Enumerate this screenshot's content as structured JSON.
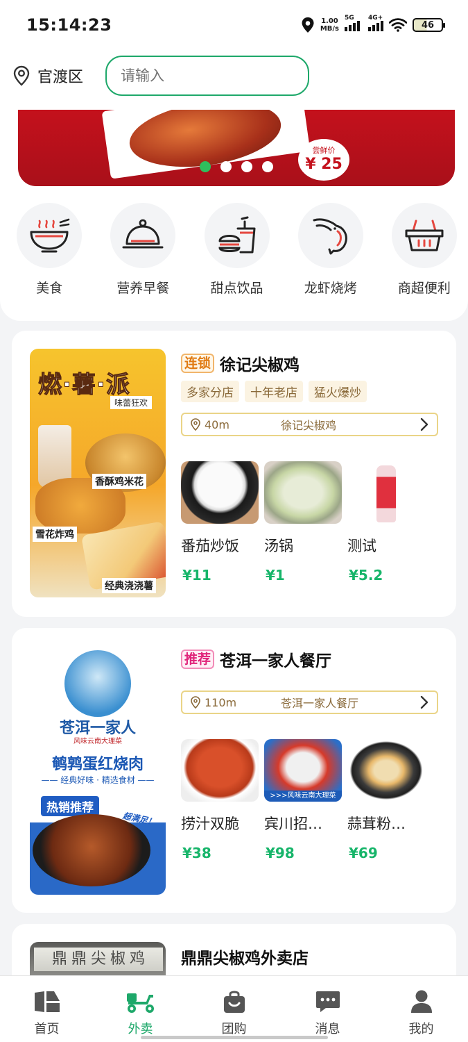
{
  "status_bar": {
    "time": "15:14:23",
    "net_speed_value": "1.00",
    "net_speed_unit": "MB/s",
    "signal1": "5G",
    "signal2": "4G+",
    "battery": "46"
  },
  "location": {
    "district": "官渡区"
  },
  "search": {
    "placeholder": "请输入"
  },
  "banner": {
    "price_label": "尝鲜价",
    "price": "¥ 25",
    "active_dot": 0,
    "dot_count": 4
  },
  "categories": [
    {
      "label": "美食",
      "icon": "bowl-icon"
    },
    {
      "label": "营养早餐",
      "icon": "cloche-icon"
    },
    {
      "label": "甜点饮品",
      "icon": "burger-drink-icon"
    },
    {
      "label": "龙虾烧烤",
      "icon": "shrimp-icon"
    },
    {
      "label": "商超便利",
      "icon": "basket-icon"
    }
  ],
  "stores": [
    {
      "badge": "连锁",
      "name": "徐记尖椒鸡",
      "tags": [
        "多家分店",
        "十年老店",
        "猛火爆炒"
      ],
      "distance": "40m",
      "branch": "徐记尖椒鸡",
      "image_text": {
        "headline": "燃·薯·派",
        "sub": "味蕾狂欢",
        "tag1": "香酥鸡米花",
        "tag2": "雪花炸鸡",
        "tag3": "经典浇浇薯"
      },
      "dishes": [
        {
          "name": "番茄炒饭",
          "price": "¥11"
        },
        {
          "name": "汤锅",
          "price": "¥1"
        },
        {
          "name": "测试",
          "price": "¥5.2"
        }
      ]
    },
    {
      "badge": "推荐",
      "name": "苍洱一家人餐厅",
      "distance": "110m",
      "branch": "苍洱一家人餐厅",
      "image_text": {
        "brand": "苍洱一家人",
        "brand_sub": "风味云南大理菜",
        "title": "鹌鹑蛋红烧肉",
        "subtitle": "—— 经典好味 · 精选食材 ——",
        "hot": "热销推荐",
        "hot2": "超满足！"
      },
      "dishes": [
        {
          "name": "捞汁双脆",
          "price": "¥38"
        },
        {
          "name": "宾川招…",
          "price": "¥98"
        },
        {
          "name": "蒜茸粉…",
          "price": "¥69"
        }
      ]
    },
    {
      "name": "鼎鼎尖椒鸡外卖店",
      "image_text": {
        "sign": "鼎鼎尖椒鸡"
      }
    }
  ],
  "bottom_nav": [
    {
      "label": "首页",
      "icon": "home-icon",
      "active": false
    },
    {
      "label": "外卖",
      "icon": "scooter-icon",
      "active": true
    },
    {
      "label": "团购",
      "icon": "bag-icon",
      "active": false
    },
    {
      "label": "消息",
      "icon": "message-icon",
      "active": false
    },
    {
      "label": "我的",
      "icon": "user-icon",
      "active": false
    }
  ],
  "colors": {
    "accent": "#1ea86a",
    "price": "#17b56a",
    "banner_red": "#c4111c"
  }
}
